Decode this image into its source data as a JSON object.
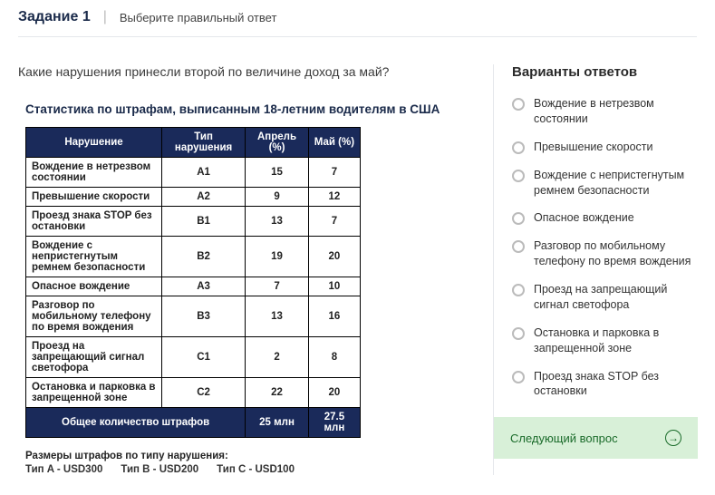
{
  "header": {
    "task_label": "Задание 1",
    "instruction": "Выберите правильный ответ"
  },
  "question": "Какие нарушения принесли второй по величине доход за май?",
  "chart_data": {
    "type": "table",
    "title": "Статистика по штрафам, выписанным 18-летним водителям в США",
    "columns": [
      "Нарушение",
      "Тип нарушения",
      "Апрель (%)",
      "Май (%)"
    ],
    "rows": [
      {
        "name": "Вождение в нетрезвом состоянии",
        "type": "A1",
        "april": 15,
        "may": 7
      },
      {
        "name": "Превышение скорости",
        "type": "A2",
        "april": 9,
        "may": 12
      },
      {
        "name": "Проезд знака STOP без остановки",
        "type": "B1",
        "april": 13,
        "may": 7
      },
      {
        "name": "Вождение с непристегнутым ремнем безопасности",
        "type": "B2",
        "april": 19,
        "may": 20
      },
      {
        "name": "Опасное вождение",
        "type": "A3",
        "april": 7,
        "may": 10
      },
      {
        "name": "Разговор по мобильному телефону по время вождения",
        "type": "B3",
        "april": 13,
        "may": 16
      },
      {
        "name": "Проезд на запрещающий сигнал светофора",
        "type": "C1",
        "april": 2,
        "may": 8
      },
      {
        "name": "Остановка и парковка в запрещенной зоне",
        "type": "C2",
        "april": 22,
        "may": 20
      }
    ],
    "total": {
      "label": "Общее количество штрафов",
      "april": "25 млн",
      "may": "27.5 млн"
    },
    "footnote_label": "Размеры штрафов по типу нарушения:",
    "fine_sizes": [
      "Тип A - USD300",
      "Тип B - USD200",
      "Тип C - USD100"
    ]
  },
  "answers": {
    "title": "Варианты ответов",
    "options": [
      "Вождение в нетрезвом состоянии",
      "Превышение скорости",
      "Вождение с непристегнутым ремнем безопасности",
      "Опасное вождение",
      "Разговор по мобильному телефону по время вождения",
      "Проезд на запрещающий сигнал светофора",
      "Остановка и парковка в запрещенной зоне",
      "Проезд знака STOP без остановки"
    ]
  },
  "next_button": "Следующий вопрос"
}
